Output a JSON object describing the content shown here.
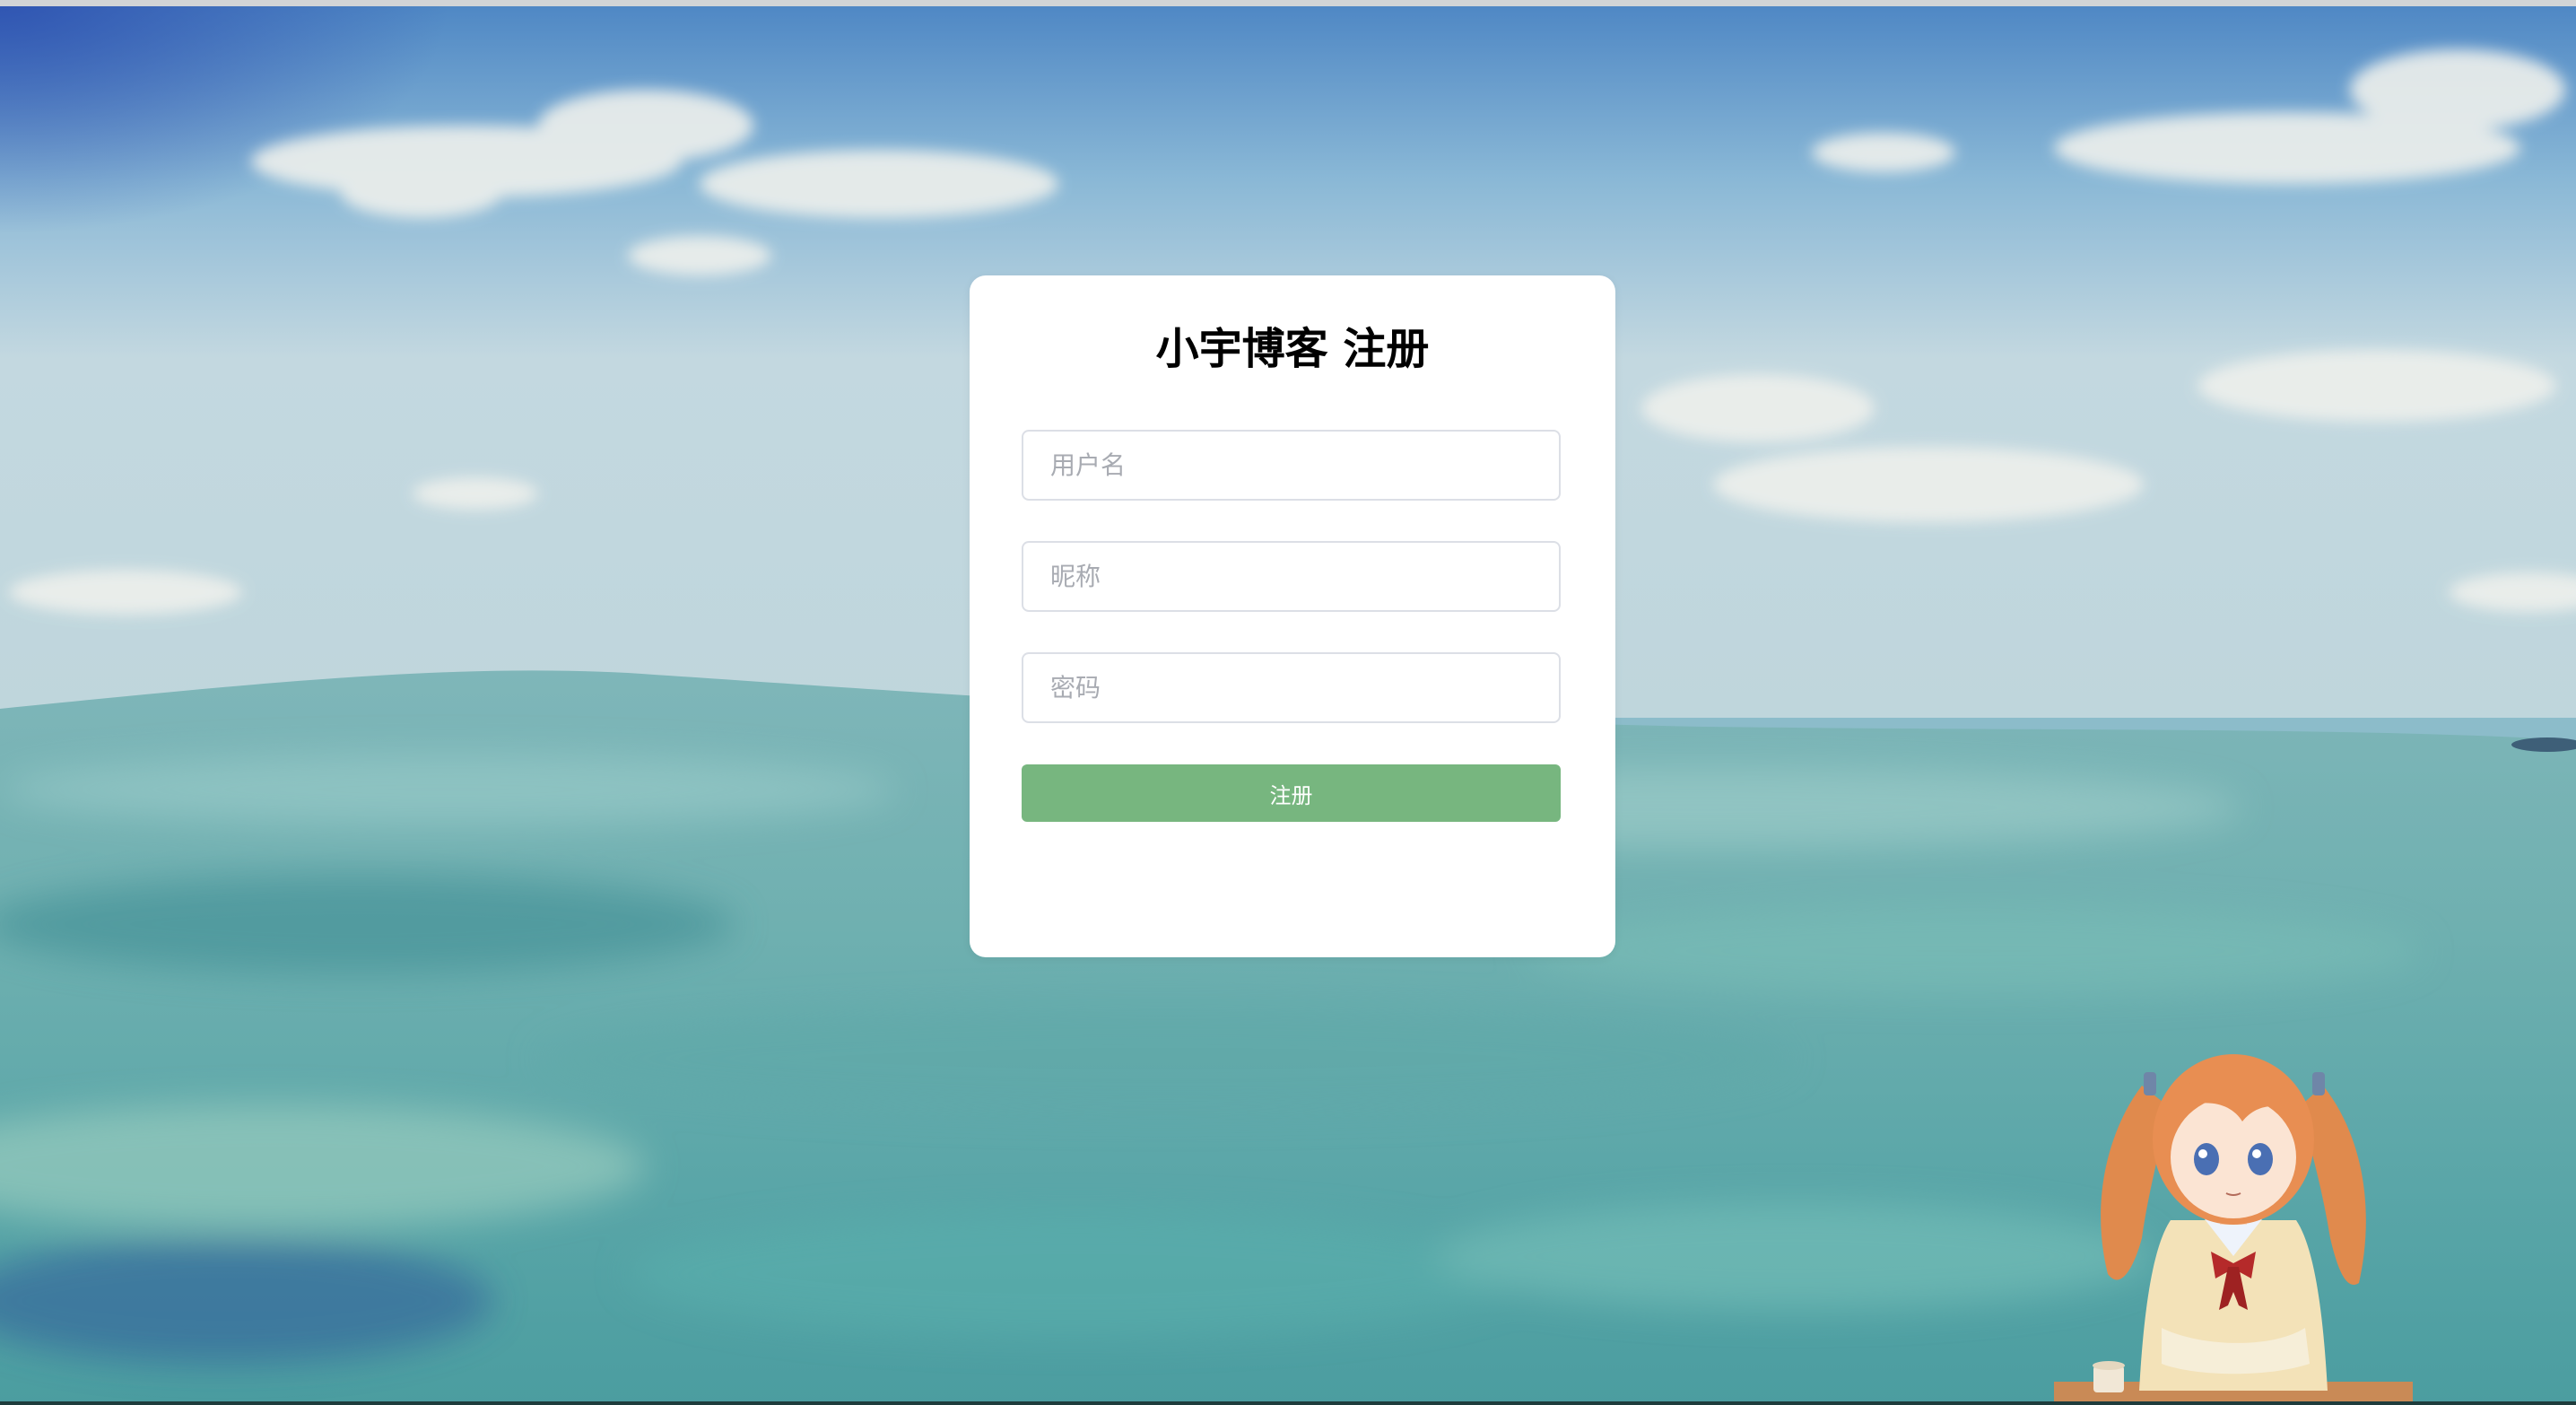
{
  "register_form": {
    "title": "小宇博客 注册",
    "username_placeholder": "用户名",
    "nickname_placeholder": "昵称",
    "password_placeholder": "密码",
    "submit_label": "注册",
    "button_color": "#77b67f"
  },
  "background": {
    "description_icon": "ocean-sky-background"
  },
  "mascot": {
    "icon": "anime-girl-mascot"
  }
}
